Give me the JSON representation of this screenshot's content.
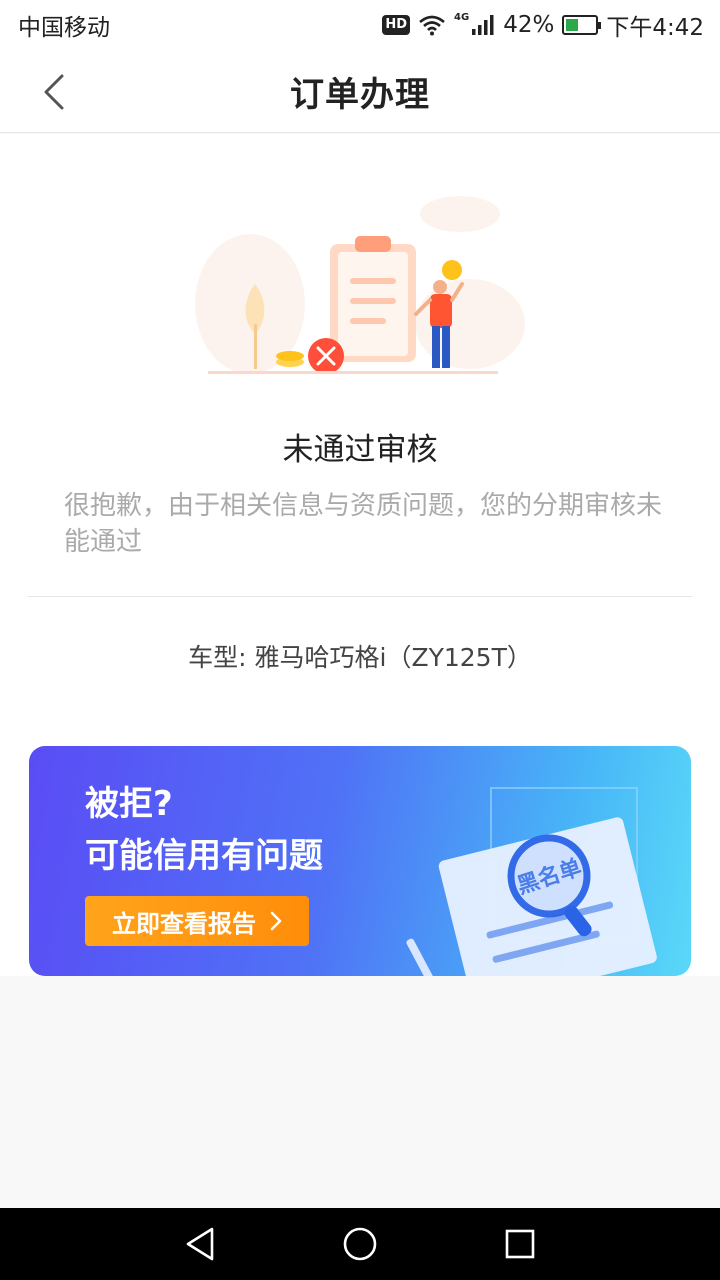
{
  "status_bar": {
    "carrier": "中国移动",
    "hd": "HD",
    "network": "4G",
    "battery_percent": "42%",
    "time": "下午4:42",
    "battery_level": 0.42,
    "battery_color": "#2aa84a"
  },
  "nav": {
    "back_icon": "chevron-left-icon",
    "title": "订单办理"
  },
  "result": {
    "illustration": "rejected-application-illustration",
    "title": "未通过审核",
    "description": "很抱歉，由于相关信息与资质问题，您的分期审核未能通过"
  },
  "vehicle": {
    "text": "车型: 雅马哈巧格i（ZY125T）"
  },
  "banner": {
    "line1": "被拒?",
    "line2": "可能信用有问题",
    "button_label": "立即查看报告",
    "button_icon": "chevron-right-icon",
    "art_label": "黑名单",
    "accent_color": "#ff9a12"
  },
  "system_nav": {
    "back_icon": "triangle-back-icon",
    "home_icon": "circle-home-icon",
    "recents_icon": "square-recents-icon"
  }
}
